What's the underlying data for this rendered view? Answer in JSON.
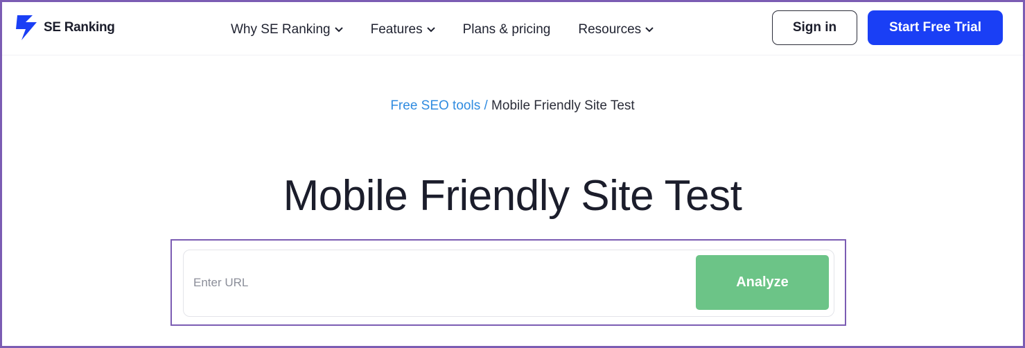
{
  "header": {
    "logo_text": "SE Ranking",
    "logo_icon": "lightning-bolt-logo",
    "nav": [
      {
        "label": "Why SE Ranking",
        "has_dropdown": true
      },
      {
        "label": "Features",
        "has_dropdown": true
      },
      {
        "label": "Plans & pricing",
        "has_dropdown": false
      },
      {
        "label": "Resources",
        "has_dropdown": true
      }
    ],
    "signin_label": "Sign in",
    "trial_label": "Start Free Trial"
  },
  "breadcrumb": {
    "link": "Free SEO tools",
    "separator": " / ",
    "current": "Mobile Friendly Site Test"
  },
  "main": {
    "title": "Mobile Friendly Site Test",
    "url_placeholder": "Enter URL",
    "analyze_label": "Analyze"
  },
  "colors": {
    "accent_blue": "#1a3ff5",
    "link_blue": "#2f8be0",
    "analyze_green": "#6cc487",
    "highlight_purple": "#7b5cb3"
  }
}
